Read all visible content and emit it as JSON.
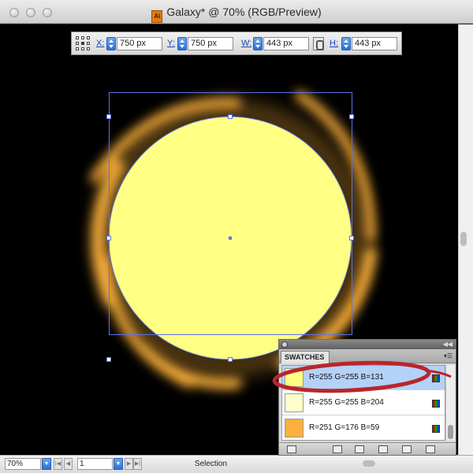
{
  "window": {
    "title": "Galaxy* @ 70% (RGB/Preview)",
    "app_icon": "illustrator-icon",
    "app_icon_text": "Ai"
  },
  "transform": {
    "x_label": "X:",
    "x_value": "750 px",
    "y_label": "Y:",
    "y_value": "750 px",
    "w_label": "W:",
    "w_value": "443 px",
    "h_label": "H:",
    "h_value": "443 px"
  },
  "canvas": {
    "fill_color": "#ffff83",
    "background": "#000000",
    "glow_color": "#fbb03b"
  },
  "status": {
    "zoom": "70%",
    "page": "1",
    "mode": "Selection"
  },
  "swatches_panel": {
    "tab_label": "SWATCHES",
    "items": [
      {
        "label": "R=255 G=255 B=131",
        "color": "#ffff83",
        "selected": true
      },
      {
        "label": "R=255 G=255 B=204",
        "color": "#ffffcc",
        "selected": false
      },
      {
        "label": "R=251 G=176 B=59",
        "color": "#fbb03b",
        "selected": false
      }
    ]
  },
  "annotation": {
    "stroke_color": "#b8262c"
  }
}
